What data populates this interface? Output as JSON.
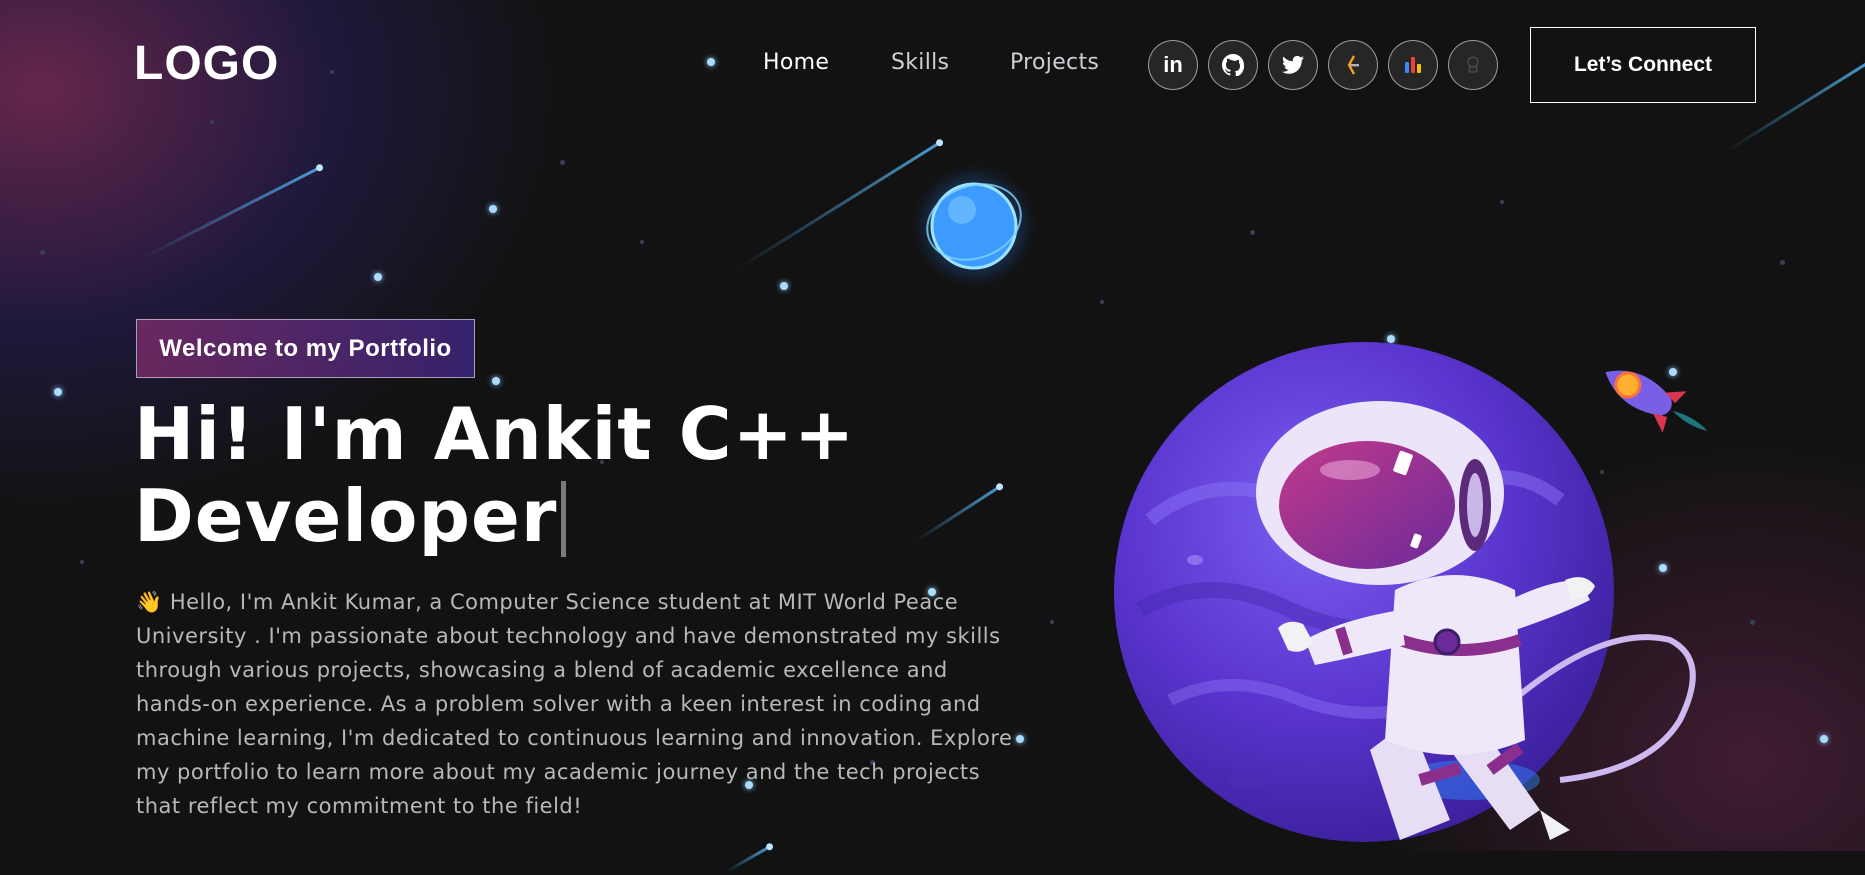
{
  "nav": {
    "logo": "LOGO",
    "links": [
      "Home",
      "Skills",
      "Projects"
    ],
    "social_icons": [
      "linkedin-icon",
      "github-icon",
      "twitter-icon",
      "codechef-icon",
      "leetcode-stats-icon",
      "kaggle-icon"
    ],
    "connect_label": "Let’s Connect"
  },
  "hero": {
    "tagline": "Welcome to my Portfolio",
    "headline_line1": "Hi! I'm Ankit C++",
    "headline_line2": "Developer",
    "intro": "👋 Hello, I'm Ankit Kumar, a Computer Science student at MIT World Peace University . I'm passionate about technology and have demonstrated my skills through various projects, showcasing a blend of academic excellence and hands-on experience. As a problem solver with a keen interest in coding and machine learning, I'm dedicated to continuous learning and innovation. Explore my portfolio to learn more about my academic journey and the tech projects that reflect my commitment to the field!"
  },
  "colors": {
    "background": "#121212",
    "accent_pink": "#AA367C",
    "accent_purple": "#4A2FBD",
    "planet_purple": "#6a3fd6",
    "star_blue": "#a9dcff"
  }
}
